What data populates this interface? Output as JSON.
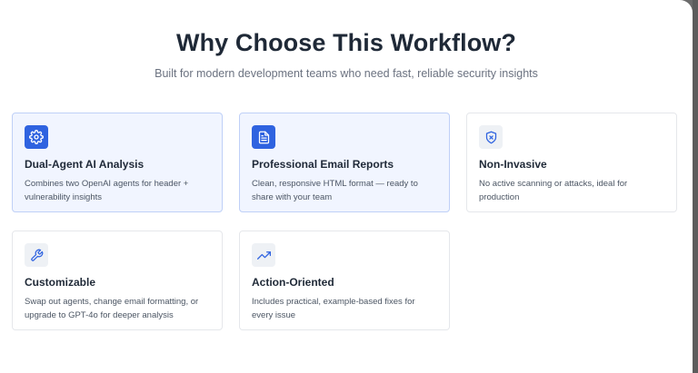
{
  "header": {
    "title": "Why Choose This Workflow?",
    "subtitle": "Built for modern development teams who need fast, reliable security insights"
  },
  "features": [
    {
      "title": "Dual-Agent AI Analysis",
      "description": "Combines two OpenAI agents for header + vulnerability insights",
      "icon": "gear-icon",
      "highlighted": true
    },
    {
      "title": "Professional Email Reports",
      "description": "Clean, responsive HTML format — ready to share with your team",
      "icon": "document-icon",
      "highlighted": true
    },
    {
      "title": "Non-Invasive",
      "description": "No active scanning or attacks, ideal for production",
      "icon": "shield-icon",
      "highlighted": false
    },
    {
      "title": "Customizable",
      "description": "Swap out agents, change email formatting, or upgrade to GPT-4o for deeper analysis",
      "icon": "wrench-icon",
      "highlighted": false
    },
    {
      "title": "Action-Oriented",
      "description": "Includes practical, example-based fixes for every issue",
      "icon": "trending-up-icon",
      "highlighted": false
    }
  ],
  "colors": {
    "accent": "#2f63e0",
    "highlight_bg": "#f1f5ff",
    "highlight_border": "#bfd0f7",
    "heading": "#1f2937",
    "muted": "#6b7280"
  }
}
